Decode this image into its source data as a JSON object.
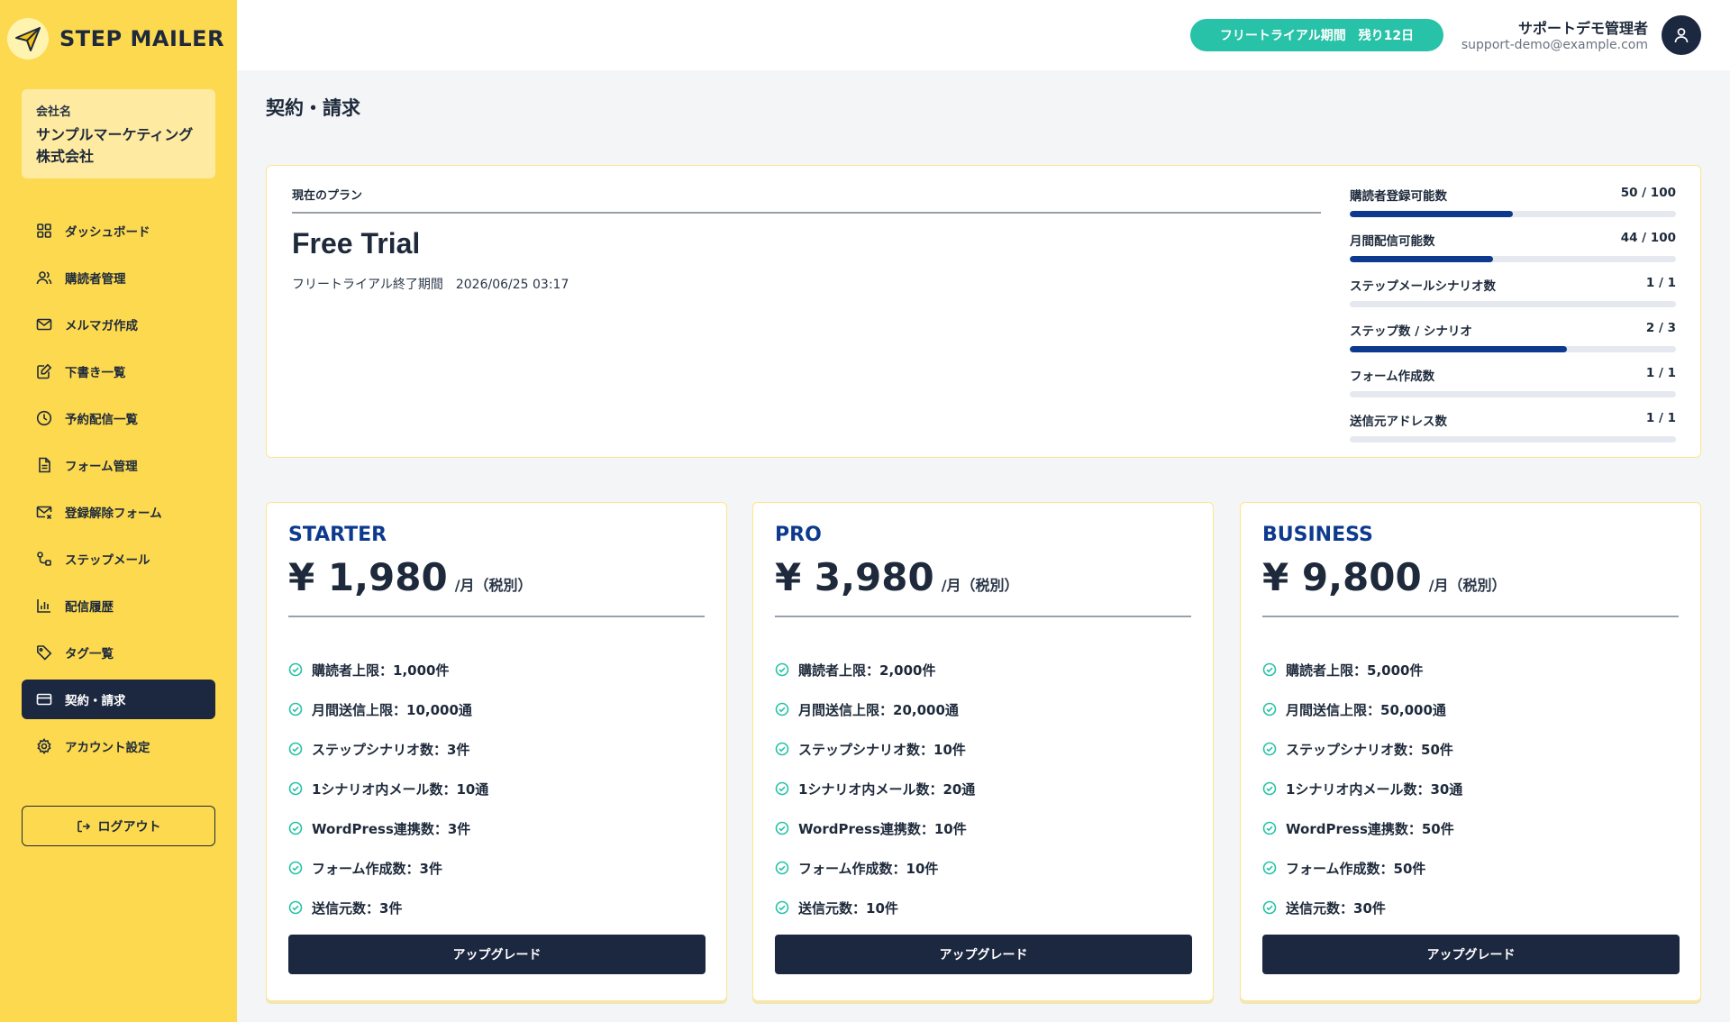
{
  "app": {
    "name": "STEP MAILER"
  },
  "company": {
    "label": "会社名",
    "name": "サンプルマーケティング株式会社"
  },
  "sidebar": {
    "items": [
      {
        "label": "ダッシュボード",
        "icon": "grid-icon",
        "active": false
      },
      {
        "label": "購読者管理",
        "icon": "users-icon",
        "active": false
      },
      {
        "label": "メルマガ作成",
        "icon": "mail-icon",
        "active": false
      },
      {
        "label": "下書き一覧",
        "icon": "edit-icon",
        "active": false
      },
      {
        "label": "予約配信一覧",
        "icon": "clock-icon",
        "active": false
      },
      {
        "label": "フォーム管理",
        "icon": "document-icon",
        "active": false
      },
      {
        "label": "登録解除フォーム",
        "icon": "mail-x-icon",
        "active": false
      },
      {
        "label": "ステップメール",
        "icon": "route-icon",
        "active": false
      },
      {
        "label": "配信履歴",
        "icon": "bar-chart-icon",
        "active": false
      },
      {
        "label": "タグ一覧",
        "icon": "tag-icon",
        "active": false
      },
      {
        "label": "契約・請求",
        "icon": "credit-card-icon",
        "active": true
      },
      {
        "label": "アカウント設定",
        "icon": "gear-icon",
        "active": false
      }
    ],
    "logout_label": "ログアウト"
  },
  "header": {
    "trial_badge": "フリートライアル期間　残り12日",
    "user_name": "サポートデモ管理者",
    "user_email": "support-demo@example.com"
  },
  "page": {
    "title": "契約・請求"
  },
  "current_plan": {
    "label": "現在のプラン",
    "name": "Free Trial",
    "trial_end_label": "フリートライアル終了期間",
    "trial_end_value": "2026/06/25 03:17",
    "usage": [
      {
        "label": "購読者登録可能数",
        "value": "50 / 100",
        "ratio": 0.5
      },
      {
        "label": "月間配信可能数",
        "value": "44 / 100",
        "ratio": 0.44
      },
      {
        "label": "ステップメールシナリオ数",
        "value": "1 / 1",
        "ratio": 0
      },
      {
        "label": "ステップ数 / シナリオ",
        "value": "2 / 3",
        "ratio": 0.667
      },
      {
        "label": "フォーム作成数",
        "value": "1 / 1",
        "ratio": 0
      },
      {
        "label": "送信元アドレス数",
        "value": "1 / 1",
        "ratio": 0
      }
    ]
  },
  "plans": [
    {
      "name": "STARTER",
      "price": "¥ 1,980",
      "unit": "/月（税別）",
      "features": [
        "購読者上限：1,000件",
        "月間送信上限：10,000通",
        "ステップシナリオ数：3件",
        "1シナリオ内メール数：10通",
        "WordPress連携数：3件",
        "フォーム作成数：3件",
        "送信元数：3件"
      ],
      "button": "アップグレード"
    },
    {
      "name": "PRO",
      "price": "¥ 3,980",
      "unit": "/月（税別）",
      "features": [
        "購読者上限：2,000件",
        "月間送信上限：20,000通",
        "ステップシナリオ数：10件",
        "1シナリオ内メール数：20通",
        "WordPress連携数：10件",
        "フォーム作成数：10件",
        "送信元数：10件"
      ],
      "button": "アップグレード"
    },
    {
      "name": "BUSINESS",
      "price": "¥ 9,800",
      "unit": "/月（税別）",
      "features": [
        "購読者上限：5,000件",
        "月間送信上限：50,000通",
        "ステップシナリオ数：50件",
        "1シナリオ内メール数：30通",
        "WordPress連携数：50件",
        "フォーム作成数：50件",
        "送信元数：30件"
      ],
      "button": "アップグレード"
    }
  ],
  "colors": {
    "sidebar_bg": "#fdd94f",
    "accent_navy": "#1c2740",
    "plan_name_blue": "#0d3a8e",
    "trial_green": "#27c2a7",
    "check_green": "#27c2a7"
  }
}
